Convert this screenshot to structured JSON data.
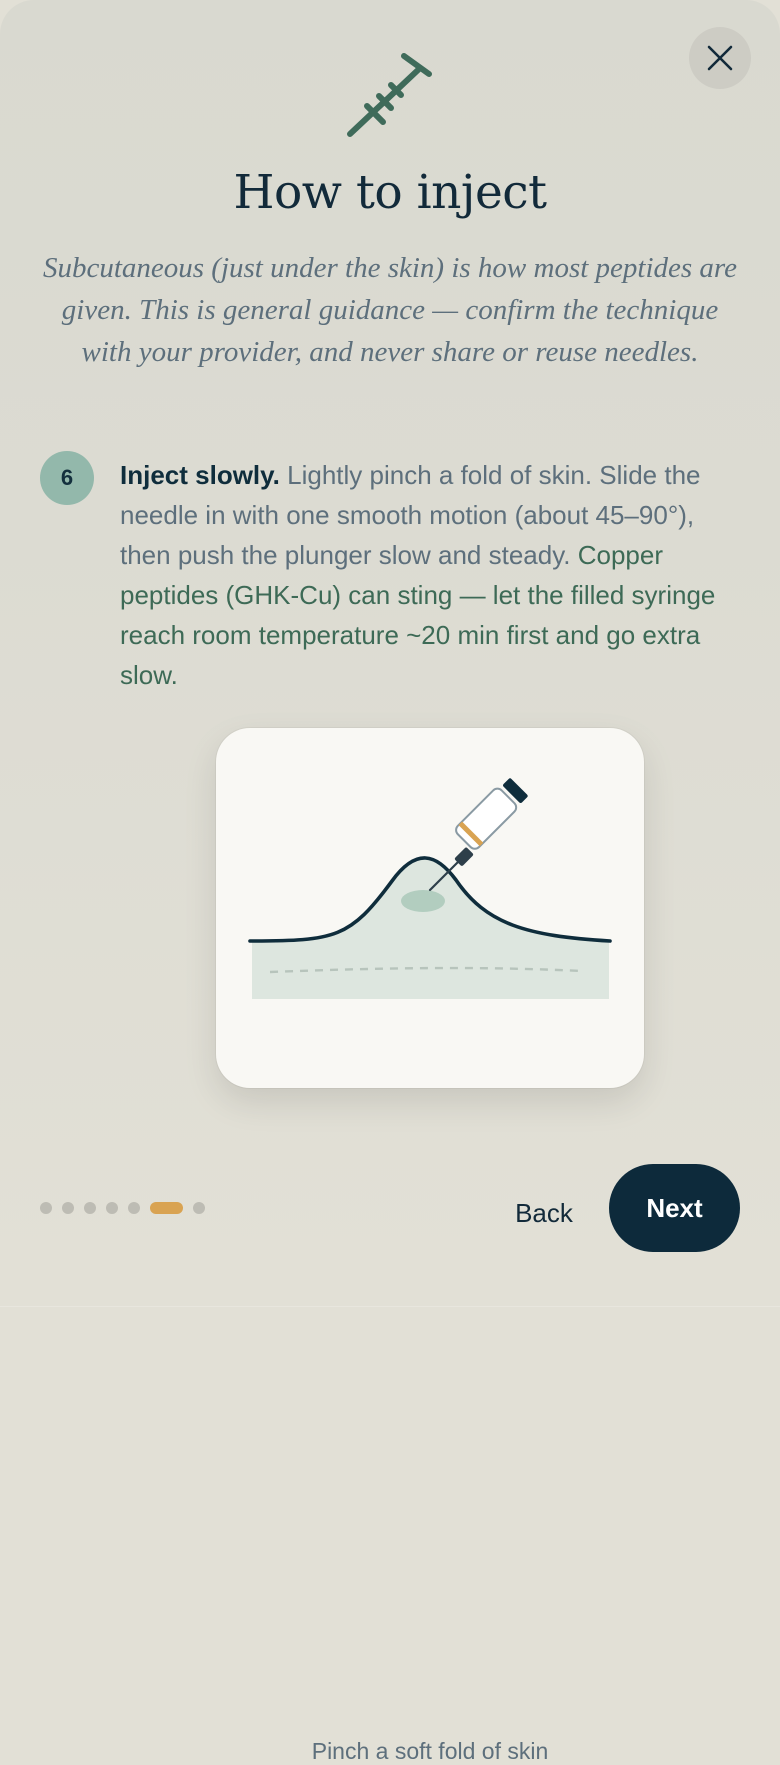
{
  "header": {
    "title": "How to inject",
    "subtitle": "Subcutaneous (just under the skin) is how most peptides are given. This is general guidance — confirm the technique with your provider, and never share or reuse needles."
  },
  "icons": {
    "header_icon": "syringe-icon",
    "close": "close-icon"
  },
  "step": {
    "number": "6",
    "lead": "Inject slowly.",
    "body": " Lightly pinch a fold of skin. Slide the needle in with one smooth motion (about 45–90°), then push the plunger slow and steady.",
    "note": " Copper peptides (GHK-Cu) can sting — let the filled syringe reach room temperature ~20 min first and go extra slow."
  },
  "illustration": {
    "caption": "Pinch a soft fold of skin"
  },
  "pager": {
    "total": 7,
    "current": 6
  },
  "nav": {
    "back_label": "Back",
    "next_label": "Next"
  },
  "colors": {
    "background": "#e2e0d6",
    "accent_teal": "#3f6b5a",
    "badge": "#93b8ab",
    "primary_button": "#0d2a3b",
    "active_dot": "#d9a352",
    "card": "#f9f8f4"
  }
}
